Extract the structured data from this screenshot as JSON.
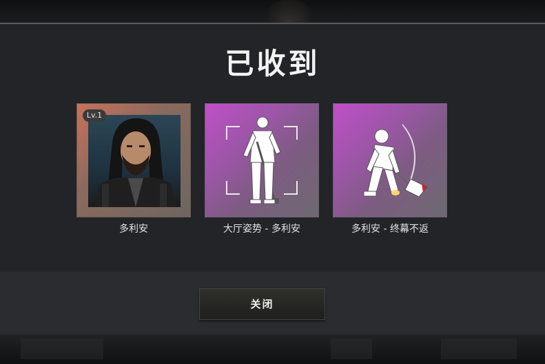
{
  "modal": {
    "title": "已收到",
    "close_label": "关闭"
  },
  "rewards": [
    {
      "label": "多利安",
      "badge": "Lv.1",
      "icon": "character-portrait"
    },
    {
      "label": "大厅姿势 - 多利安",
      "icon": "lobby-pose-figure"
    },
    {
      "label": "多利安 - 终幕不返",
      "icon": "emote-figure-axe"
    }
  ],
  "colors": {
    "panel": "#222427",
    "purple_card": "#c04fc9",
    "hero_card": "#c9725a"
  }
}
